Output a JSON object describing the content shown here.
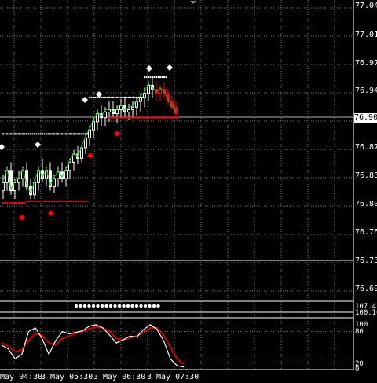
{
  "colors": {
    "background": "#000000",
    "grid": "#c8c8c8",
    "bull_candle": "#ffffff",
    "bear_candle": "#ff0000",
    "fast_ma": "#00cc00",
    "stoch_main": "#ffffff",
    "stoch_signal": "#cc0000",
    "separator": "#ffffff",
    "current_price_line": "#b0b0b0"
  },
  "price_axis": {
    "labels": [
      "77.045",
      "77.010",
      "76.975",
      "76.940",
      "76.870",
      "76.835",
      "76.800",
      "76.765",
      "76.730",
      "76.695"
    ],
    "current_price": "76.907"
  },
  "indicator_axis": {
    "label_a": "107.41",
    "label_b": "100.10"
  },
  "stoch_axis": {
    "labels": [
      "100",
      "80",
      "20",
      "0"
    ]
  },
  "time_axis": {
    "labels": [
      "May 04:30",
      "3 May 05:30",
      "3 May 06:30",
      "3 May 07:30"
    ]
  },
  "chart_data": {
    "type": "candlestick",
    "ylim": [
      76.68,
      77.05
    ],
    "candles": [
      [
        76.815,
        76.835,
        76.805,
        76.825
      ],
      [
        76.825,
        76.845,
        76.815,
        76.84
      ],
      [
        76.84,
        76.85,
        76.81,
        76.815
      ],
      [
        76.815,
        76.83,
        76.805,
        76.825
      ],
      [
        76.825,
        76.84,
        76.815,
        76.83
      ],
      [
        76.83,
        76.845,
        76.82,
        76.84
      ],
      [
        76.84,
        76.85,
        76.815,
        76.82
      ],
      [
        76.82,
        76.83,
        76.805,
        76.81
      ],
      [
        76.81,
        76.83,
        76.805,
        76.825
      ],
      [
        76.825,
        76.845,
        76.815,
        76.84
      ],
      [
        76.84,
        76.855,
        76.825,
        76.83
      ],
      [
        76.83,
        76.845,
        76.82,
        76.84
      ],
      [
        76.84,
        76.85,
        76.815,
        76.82
      ],
      [
        76.82,
        76.835,
        76.812,
        76.83
      ],
      [
        76.83,
        76.845,
        76.82,
        76.838
      ],
      [
        76.838,
        76.85,
        76.825,
        76.83
      ],
      [
        76.83,
        76.845,
        76.82,
        76.84
      ],
      [
        76.84,
        76.855,
        76.83,
        76.85
      ],
      [
        76.85,
        76.865,
        76.84,
        76.86
      ],
      [
        76.86,
        76.87,
        76.848,
        76.855
      ],
      [
        76.855,
        76.872,
        76.85,
        76.868
      ],
      [
        76.868,
        76.885,
        76.86,
        76.88
      ],
      [
        76.88,
        76.895,
        76.87,
        76.89
      ],
      [
        76.89,
        76.905,
        76.88,
        76.9
      ],
      [
        76.9,
        76.915,
        76.89,
        76.91
      ],
      [
        76.91,
        76.92,
        76.895,
        76.905
      ],
      [
        76.905,
        76.918,
        76.895,
        76.912
      ],
      [
        76.912,
        76.925,
        76.9,
        76.915
      ],
      [
        76.915,
        76.925,
        76.905,
        76.91
      ],
      [
        76.91,
        76.92,
        76.898,
        76.915
      ],
      [
        76.915,
        76.928,
        76.905,
        76.92
      ],
      [
        76.92,
        76.93,
        76.905,
        76.912
      ],
      [
        76.912,
        76.922,
        76.902,
        76.915
      ],
      [
        76.915,
        76.925,
        76.905,
        76.918
      ],
      [
        76.918,
        76.93,
        76.908,
        76.925
      ],
      [
        76.925,
        76.935,
        76.912,
        76.93
      ],
      [
        76.93,
        76.942,
        76.918,
        76.935
      ],
      [
        76.935,
        76.95,
        76.925,
        76.945
      ],
      [
        76.945,
        76.955,
        76.93,
        76.94
      ],
      [
        76.94,
        76.95,
        76.925,
        76.935
      ],
      [
        76.935,
        76.945,
        76.925,
        76.94
      ],
      [
        76.94,
        76.948,
        76.928,
        76.935
      ],
      [
        76.935,
        76.94,
        76.92,
        76.925
      ],
      [
        76.925,
        76.932,
        76.915,
        76.918
      ],
      [
        76.918,
        76.925,
        76.905,
        76.91
      ]
    ],
    "upper_band": [
      76.885,
      76.885,
      76.885,
      76.885,
      76.885,
      76.885,
      76.885,
      76.885,
      76.885,
      76.885,
      76.885,
      76.885,
      76.885,
      76.885,
      76.885,
      76.885,
      76.885,
      76.885,
      76.885,
      76.885,
      76.885,
      76.885,
      76.93,
      76.93,
      76.93,
      76.93,
      76.93,
      76.93,
      76.93,
      76.93,
      76.93,
      76.93,
      76.93,
      76.93,
      76.93,
      76.93,
      76.955,
      76.955,
      76.955,
      76.955,
      76.955,
      76.955,
      null,
      null,
      null
    ],
    "lower_band": [
      76.8,
      76.8,
      76.8,
      76.8,
      76.8,
      76.8,
      76.802,
      76.802,
      76.802,
      76.802,
      76.802,
      76.802,
      76.802,
      76.802,
      76.802,
      76.802,
      76.802,
      76.802,
      76.802,
      76.802,
      76.802,
      76.802,
      null,
      null,
      null,
      null,
      null,
      76.905,
      76.905,
      76.905,
      76.905,
      76.905,
      76.905,
      76.905,
      76.905,
      76.905,
      76.905,
      76.905,
      76.905,
      76.905,
      76.905,
      76.905,
      76.905,
      76.905,
      76.905
    ]
  }
}
